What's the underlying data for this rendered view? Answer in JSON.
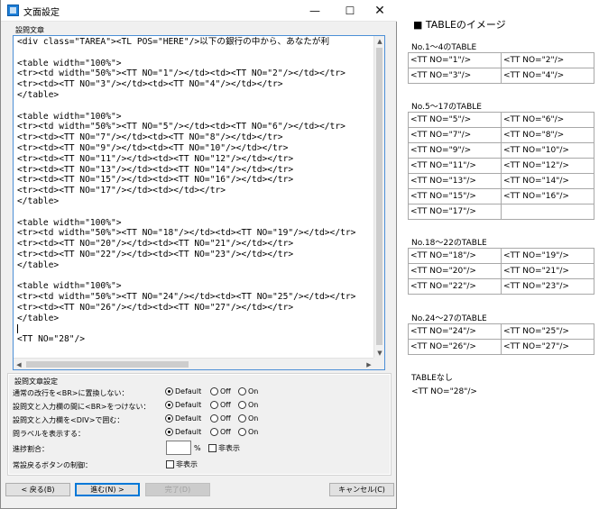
{
  "window": {
    "title": "文面設定",
    "minimize_glyph": "—",
    "maximize_glyph": "☐",
    "close_glyph": "✕"
  },
  "editor": {
    "label": "設問文章",
    "lines": [
      "<div class=\"TAREA\"><TL POS=\"HERE\"/>以下の銀行の中から、あなたが利",
      "",
      "<table width=\"100%\">",
      "<tr><td width=\"50%\"><TT NO=\"1\"/></td><td><TT NO=\"2\"/></td></tr>",
      "<tr><td><TT NO=\"3\"/></td><td><TT NO=\"4\"/></td></tr>",
      "</table>",
      "",
      "<table width=\"100%\">",
      "<tr><td width=\"50%\"><TT NO=\"5\"/></td><td><TT NO=\"6\"/></td></tr>",
      "<tr><td><TT NO=\"7\"/></td><td><TT NO=\"8\"/></td></tr>",
      "<tr><td><TT NO=\"9\"/></td><td><TT NO=\"10\"/></td></tr>",
      "<tr><td><TT NO=\"11\"/></td><td><TT NO=\"12\"/></td></tr>",
      "<tr><td><TT NO=\"13\"/></td><td><TT NO=\"14\"/></td></tr>",
      "<tr><td><TT NO=\"15\"/></td><td><TT NO=\"16\"/></td></tr>",
      "<tr><td><TT NO=\"17\"/></td><td></td></tr>",
      "</table>",
      "",
      "<table width=\"100%\">",
      "<tr><td width=\"50%\"><TT NO=\"18\"/></td><td><TT NO=\"19\"/></td></tr>",
      "<tr><td><TT NO=\"20\"/></td><td><TT NO=\"21\"/></td></tr>",
      "<tr><td><TT NO=\"22\"/></td><td><TT NO=\"23\"/></td></tr>",
      "</table>",
      "",
      "<table width=\"100%\">",
      "<tr><td width=\"50%\"><TT NO=\"24\"/></td><td><TT NO=\"25\"/></td></tr>",
      "<tr><td><TT NO=\"26\"/></td><td><TT NO=\"27\"/></td></tr>",
      "</table>",
      "",
      "<TT NO=\"28\"/>"
    ]
  },
  "settings": {
    "label": "設問文章設定",
    "rows": [
      {
        "label": "通常の改行を<BR>に置換しない：",
        "options": [
          "Default",
          "Off",
          "On"
        ],
        "selected": "Default"
      },
      {
        "label": "設問文と入力欄の間に<BR>をつけない：",
        "options": [
          "Default",
          "Off",
          "On"
        ],
        "selected": "Default"
      },
      {
        "label": "設問文と入力欄を<DIV>で囲む：",
        "options": [
          "Default",
          "Off",
          "On"
        ],
        "selected": "Default"
      },
      {
        "label": "問ラベルを表示する：",
        "options": [
          "Default",
          "Off",
          "On"
        ],
        "selected": "Default"
      }
    ],
    "progress": {
      "label": "進捗割合：",
      "value": "",
      "unit": "%",
      "hide_label": "非表示",
      "hide_checked": false
    },
    "back_button_control": {
      "label": "常設戻るボタンの制御：",
      "hide_label": "非表示",
      "hide_checked": false
    }
  },
  "buttons": {
    "back": "< 戻る(B)",
    "next": "進む(N) >",
    "finish": "完了(D)",
    "cancel": "キャンセル(C)"
  },
  "reference": {
    "title": "■ TABLEのイメージ",
    "groups": [
      {
        "heading": "No.1～4のTABLE",
        "rows": [
          [
            "<TT NO=\"1\"/>",
            "<TT NO=\"2\"/>"
          ],
          [
            "<TT NO=\"3\"/>",
            "<TT NO=\"4\"/>"
          ]
        ]
      },
      {
        "heading": "No.5～17のTABLE",
        "rows": [
          [
            "<TT NO=\"5\"/>",
            "<TT NO=\"6\"/>"
          ],
          [
            "<TT NO=\"7\"/>",
            "<TT NO=\"8\"/>"
          ],
          [
            "<TT NO=\"9\"/>",
            "<TT NO=\"10\"/>"
          ],
          [
            "<TT NO=\"11\"/>",
            "<TT NO=\"12\"/>"
          ],
          [
            "<TT NO=\"13\"/>",
            "<TT NO=\"14\"/>"
          ],
          [
            "<TT NO=\"15\"/>",
            "<TT NO=\"16\"/>"
          ],
          [
            "<TT NO=\"17\"/>",
            ""
          ]
        ]
      },
      {
        "heading": "No.18～22のTABLE",
        "rows": [
          [
            "<TT NO=\"18\"/>",
            "<TT NO=\"19\"/>"
          ],
          [
            "<TT NO=\"20\"/>",
            "<TT NO=\"21\"/>"
          ],
          [
            "<TT NO=\"22\"/>",
            "<TT NO=\"23\"/>"
          ]
        ]
      },
      {
        "heading": "No.24～27のTABLE",
        "rows": [
          [
            "<TT NO=\"24\"/>",
            "<TT NO=\"25\"/>"
          ],
          [
            "<TT NO=\"26\"/>",
            "<TT NO=\"27\"/>"
          ]
        ]
      }
    ],
    "no_table_heading": "TABLEなし",
    "no_table_item": "<TT NO=\"28\"/>"
  }
}
